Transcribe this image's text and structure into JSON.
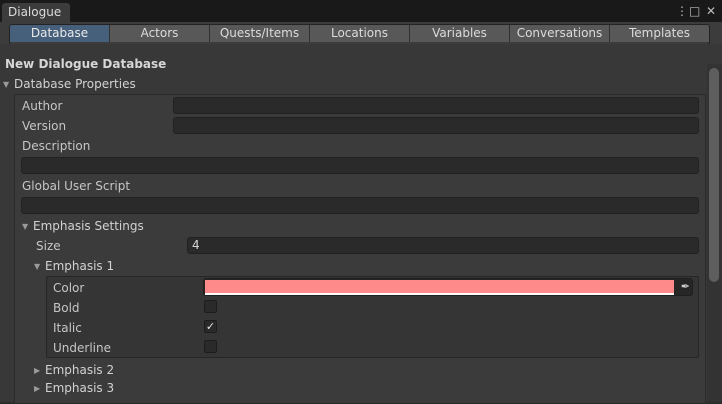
{
  "window": {
    "tab_title": "Dialogue",
    "controls": {
      "menu": "⋮",
      "maximize": "□",
      "close": "✕"
    }
  },
  "tabs": [
    "Database",
    "Actors",
    "Quests/Items",
    "Locations",
    "Variables",
    "Conversations",
    "Templates"
  ],
  "active_tab": "Database",
  "database": {
    "title": "New Dialogue Database",
    "properties_label": "Database Properties",
    "author_label": "Author",
    "author_value": "",
    "version_label": "Version",
    "version_value": "",
    "description_label": "Description",
    "description_value": "",
    "global_script_label": "Global User Script",
    "global_script_value": "",
    "emphasis": {
      "label": "Emphasis Settings",
      "size_label": "Size",
      "size_value": "4",
      "item1": {
        "label": "Emphasis 1",
        "color_label": "Color",
        "color_value": "#ff8a8a",
        "bold_label": "Bold",
        "bold_checked": false,
        "italic_label": "Italic",
        "italic_checked": true,
        "underline_label": "Underline",
        "underline_checked": false
      },
      "item2_label": "Emphasis 2",
      "item3_label": "Emphasis 3"
    }
  },
  "colors": {
    "accent_tab": "#46607c",
    "background": "#383838"
  },
  "icons": {
    "expanded": "triangle-down-icon",
    "collapsed": "triangle-right-icon",
    "eyedropper": "eyedropper-icon"
  }
}
